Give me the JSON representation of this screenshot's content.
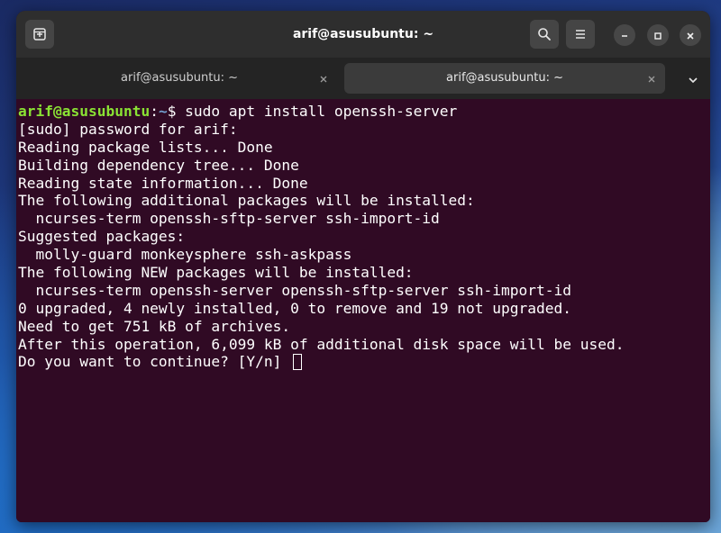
{
  "window": {
    "title": "arif@asusubuntu: ~"
  },
  "titlebar": {
    "new_tab_icon": "new-tab-icon",
    "search_icon": "search-icon",
    "menu_icon": "hamburger-menu-icon",
    "minimize_icon": "minimize-icon",
    "maximize_icon": "maximize-icon",
    "close_icon": "close-icon"
  },
  "tabs": [
    {
      "label": "arif@asusubuntu: ~",
      "active": false
    },
    {
      "label": "arif@asusubuntu: ~",
      "active": true
    }
  ],
  "terminal": {
    "prompt_user": "arif@asusubuntu",
    "prompt_sep": ":",
    "prompt_path": "~",
    "prompt_symbol": "$",
    "command": " sudo apt install openssh-server",
    "output": [
      "[sudo] password for arif:",
      "Reading package lists... Done",
      "Building dependency tree... Done",
      "Reading state information... Done",
      "The following additional packages will be installed:",
      "  ncurses-term openssh-sftp-server ssh-import-id",
      "Suggested packages:",
      "  molly-guard monkeysphere ssh-askpass",
      "The following NEW packages will be installed:",
      "  ncurses-term openssh-server openssh-sftp-server ssh-import-id",
      "0 upgraded, 4 newly installed, 0 to remove and 19 not upgraded.",
      "Need to get 751 kB of archives.",
      "After this operation, 6,099 kB of additional disk space will be used."
    ],
    "question": "Do you want to continue? [Y/n] "
  },
  "colors": {
    "terminal_bg": "#300a24",
    "prompt_user": "#8ae234",
    "prompt_path": "#729fcf",
    "titlebar_bg": "#2e2e2e",
    "tabbar_bg": "#242424"
  }
}
